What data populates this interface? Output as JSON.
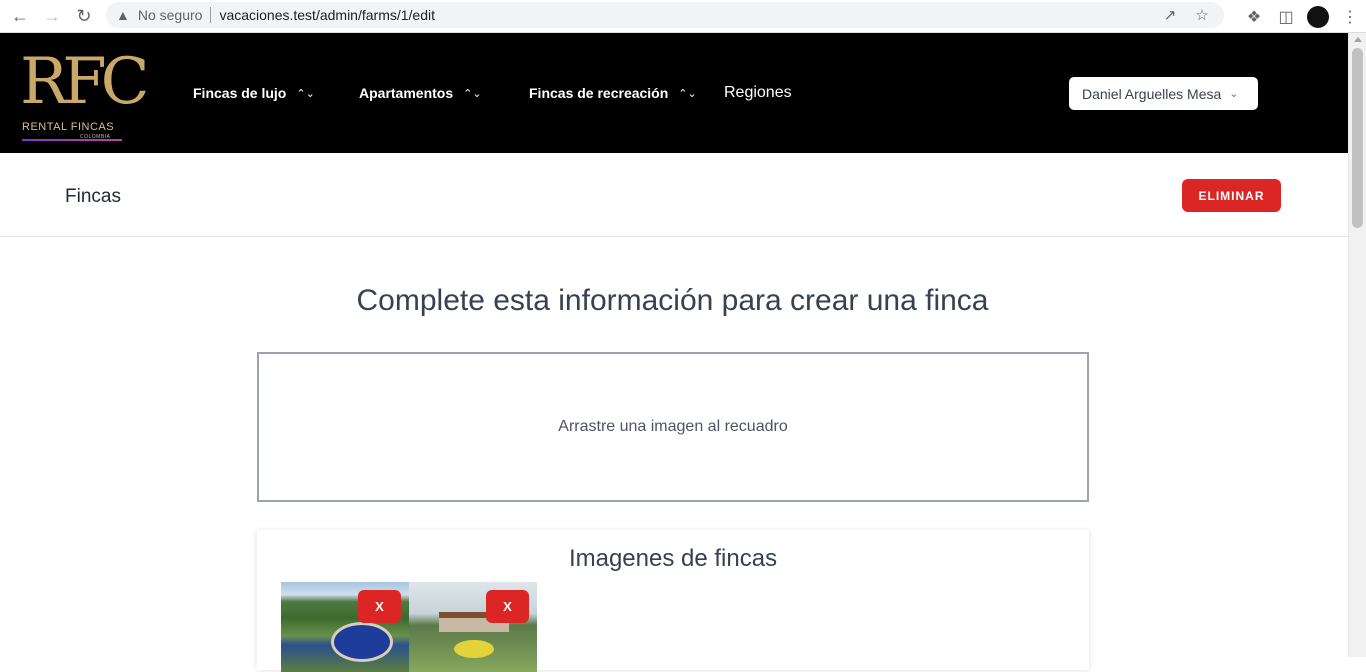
{
  "browser": {
    "security_label": "No seguro",
    "url": "vacaciones.test/admin/farms/1/edit"
  },
  "header": {
    "logo_monogram": "RFC",
    "logo_brand": "RENTAL FINCAS",
    "logo_country": "COLOMBIA",
    "menu": [
      {
        "label": "Fincas de lujo",
        "has_dropdown": true
      },
      {
        "label": "Apartamentos",
        "has_dropdown": true
      },
      {
        "label": "Fincas de recreación",
        "has_dropdown": true
      },
      {
        "label": "Regiones",
        "has_dropdown": false
      }
    ],
    "user_name": "Daniel Arguelles Mesa"
  },
  "subheader": {
    "title": "Fincas",
    "delete_label": "ELIMINAR"
  },
  "main": {
    "heading": "Complete esta información para crear una finca",
    "dropzone_text": "Arrastre una imagen al recuadro",
    "images_title": "Imagenes de fincas",
    "images": [
      {
        "remove_label": "X"
      },
      {
        "remove_label": "X"
      }
    ]
  },
  "colors": {
    "header_bg": "#000000",
    "danger": "#dc2626",
    "logo_gold": "#c9a86a"
  }
}
